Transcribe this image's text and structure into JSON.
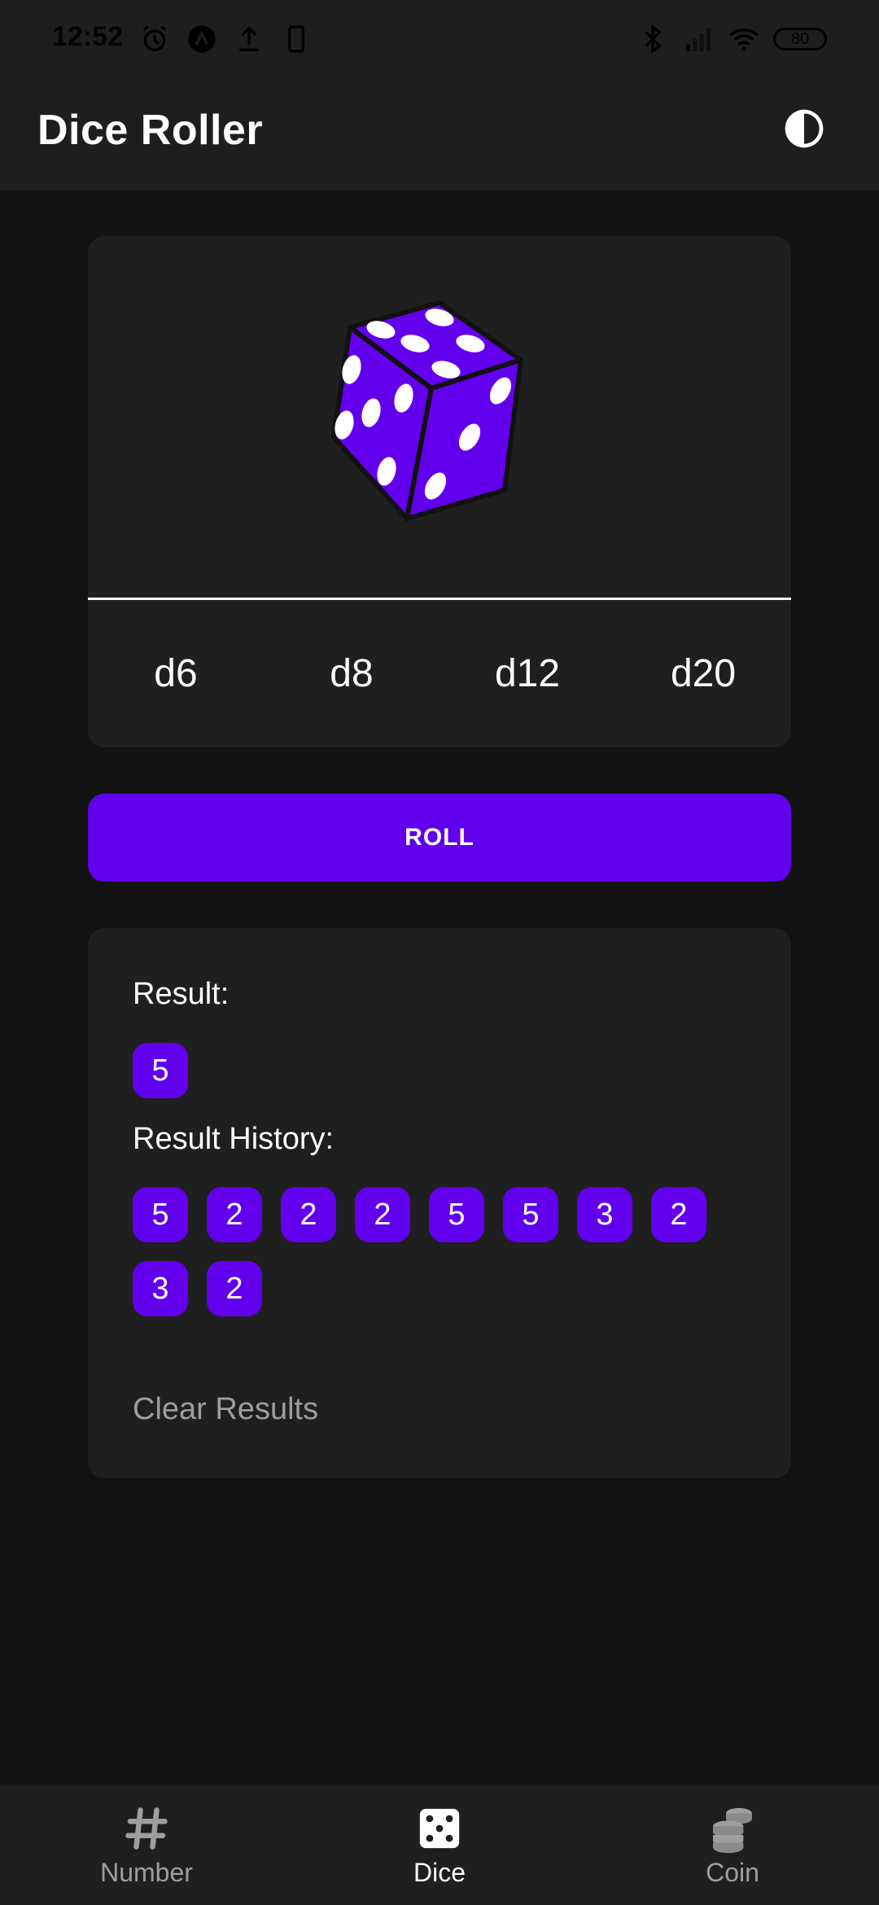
{
  "status_bar": {
    "time": "12:52",
    "battery": "80"
  },
  "app_bar": {
    "title": "Dice Roller",
    "theme_icon": "contrast-icon"
  },
  "dice_card": {
    "dice_icon": "dice-icon",
    "tabs": [
      {
        "label": "d6"
      },
      {
        "label": "d8"
      },
      {
        "label": "d12"
      },
      {
        "label": "d20"
      }
    ]
  },
  "roll_button": {
    "label": "ROLL"
  },
  "results": {
    "result_label": "Result:",
    "result_value": "5",
    "history_label": "Result History:",
    "history": [
      "5",
      "2",
      "2",
      "2",
      "5",
      "5",
      "3",
      "2",
      "3",
      "2"
    ],
    "clear_label": "Clear Results"
  },
  "bottom_nav": {
    "items": [
      {
        "label": "Number",
        "icon": "hash-icon"
      },
      {
        "label": "Dice",
        "icon": "dice-icon"
      },
      {
        "label": "Coin",
        "icon": "coins-icon"
      }
    ],
    "active": "Dice"
  },
  "colors": {
    "accent": "#6200ee",
    "surface": "#1f1f20",
    "background": "#121212"
  }
}
